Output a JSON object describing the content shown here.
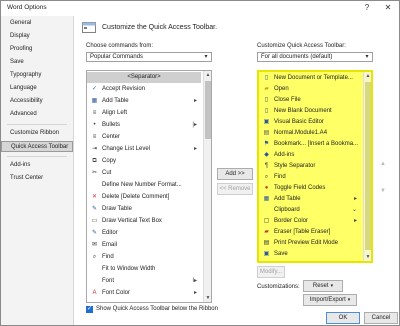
{
  "window": {
    "title": "Word Options",
    "help_glyph": "?",
    "close_glyph": "✕"
  },
  "nav": {
    "items": [
      {
        "label": "General"
      },
      {
        "label": "Display"
      },
      {
        "label": "Proofing"
      },
      {
        "label": "Save"
      },
      {
        "label": "Typography"
      },
      {
        "label": "Language"
      },
      {
        "label": "Accessibility"
      },
      {
        "label": "Advanced"
      },
      {
        "label": "Customize Ribbon"
      },
      {
        "label": "Quick Access Toolbar",
        "selected": true
      },
      {
        "label": "Add-ins"
      },
      {
        "label": "Trust Center"
      }
    ]
  },
  "header": {
    "title": "Customize the Quick Access Toolbar."
  },
  "left": {
    "label": "Choose commands from:",
    "combo_value": "Popular Commands",
    "items": [
      {
        "label": "<Separator>",
        "icon": "",
        "selected": true
      },
      {
        "label": "Accept Revision",
        "icon": "accept-revision-icon"
      },
      {
        "label": "Add Table",
        "icon": "table-icon",
        "sub": "▸"
      },
      {
        "label": "Align Left",
        "icon": "align-left-icon"
      },
      {
        "label": "Bullets",
        "icon": "bullets-icon",
        "sub": "|▸"
      },
      {
        "label": "Center",
        "icon": "center-icon"
      },
      {
        "label": "Change List Level",
        "icon": "list-level-icon",
        "sub": "▸"
      },
      {
        "label": "Copy",
        "icon": "copy-icon"
      },
      {
        "label": "Cut",
        "icon": "cut-icon"
      },
      {
        "label": "Define New Number Format...",
        "icon": ""
      },
      {
        "label": "Delete [Delete Comment]",
        "icon": "delete-comment-icon"
      },
      {
        "label": "Draw Table",
        "icon": "draw-table-icon"
      },
      {
        "label": "Draw Vertical Text Box",
        "icon": "text-box-icon"
      },
      {
        "label": "Editor",
        "icon": "editor-icon"
      },
      {
        "label": "Email",
        "icon": "email-icon"
      },
      {
        "label": "Find",
        "icon": "find-icon"
      },
      {
        "label": "Fit to Window Width",
        "icon": ""
      },
      {
        "label": "Font",
        "icon": "",
        "sub": "I▸"
      },
      {
        "label": "Font Color",
        "icon": "font-color-icon",
        "sub": "▸"
      }
    ]
  },
  "middle": {
    "add_label": "Add >>",
    "remove_label": "<< Remove"
  },
  "right": {
    "label": "Customize Quick Access Toolbar:",
    "combo_value": "For all documents (default)",
    "items": [
      {
        "label": "New Document or Template...",
        "icon": "new-doc-icon"
      },
      {
        "label": "Open",
        "icon": "open-folder-icon"
      },
      {
        "label": "Close File",
        "icon": "close-file-icon"
      },
      {
        "label": "New Blank Document",
        "icon": "blank-doc-icon"
      },
      {
        "label": "Visual Basic Editor",
        "icon": "vba-icon"
      },
      {
        "label": "Normal.Module1.A4",
        "icon": "macro-icon"
      },
      {
        "label": "Bookmark... [Insert a Bookma...",
        "icon": "bookmark-icon"
      },
      {
        "label": "Add-ins",
        "icon": "addins-icon"
      },
      {
        "label": "Style Separator",
        "icon": "style-sep-icon"
      },
      {
        "label": "Find",
        "icon": "find-icon"
      },
      {
        "label": "Toggle Field Codes",
        "icon": "field-codes-icon"
      },
      {
        "label": "Add Table",
        "icon": "table-icon",
        "sub": "▸"
      },
      {
        "label": "Clipboard",
        "icon": "",
        "sub": "⌄"
      },
      {
        "label": "Border Color",
        "icon": "border-color-icon",
        "sub": "▸"
      },
      {
        "label": "Eraser [Table Eraser]",
        "icon": "eraser-icon"
      },
      {
        "label": "Print Preview Edit Mode",
        "icon": "print-preview-icon"
      },
      {
        "label": "Save",
        "icon": "save-icon"
      }
    ],
    "modify_label": "Modify..."
  },
  "bottom": {
    "show_below_label": "Show Quick Access Toolbar below the Ribbon",
    "customizations_label": "Customizations:",
    "reset_label": "Reset",
    "import_export_label": "Import/Export",
    "ok_label": "OK",
    "cancel_label": "Cancel"
  },
  "colors": {
    "highlight": "#ffff66",
    "selected_nav": "#d6d6d6",
    "checkbox": "#1f6fce"
  }
}
